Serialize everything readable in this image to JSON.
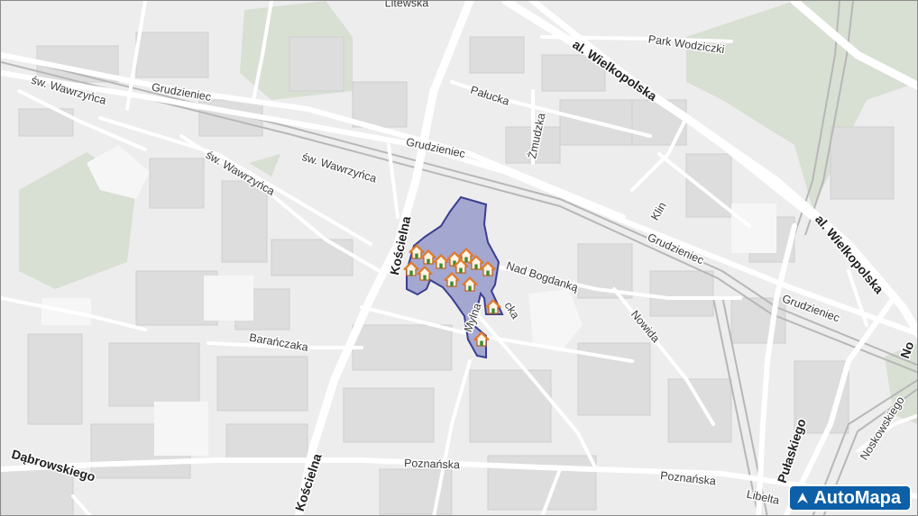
{
  "brand": {
    "name": "AutoMapa"
  },
  "colors": {
    "background": "#ededed",
    "road": "#ffffff",
    "block": "#dcdcdc",
    "green": "#d5ddd1",
    "rail": "#b4b4b4",
    "area_fill": "#8f93c8",
    "area_stroke": "#3a3f8f",
    "marker_house": "#e07b2a"
  },
  "streets": [
    {
      "name": "Litewska"
    },
    {
      "name": "Park Wodziczki"
    },
    {
      "name": "al. Wielkopolska"
    },
    {
      "name": "św. Wawrzyńca"
    },
    {
      "name": "Grudzieniec"
    },
    {
      "name": "Pałucka"
    },
    {
      "name": "Żmudzka"
    },
    {
      "name": "Grudzieniec"
    },
    {
      "name": "św. Wawrzyńca"
    },
    {
      "name": "św. Wawrzyńca"
    },
    {
      "name": "Klin"
    },
    {
      "name": "al. Wielkopolska"
    },
    {
      "name": "Kościelna"
    },
    {
      "name": "Grudzieniec"
    },
    {
      "name": "Nad Bogdanką"
    },
    {
      "name": "Grudzieniec"
    },
    {
      "name": "Nowida"
    },
    {
      "name": "Barańczaka"
    },
    {
      "name": "Noskowskiego"
    },
    {
      "name": "Pułaskiego"
    },
    {
      "name": "Dąbrowskiego"
    },
    {
      "name": "Kościelna"
    },
    {
      "name": "Poznańska"
    },
    {
      "name": "Poznańska"
    },
    {
      "name": "Libelta"
    },
    {
      "name": "Mylna"
    },
    {
      "name": "cka"
    },
    {
      "name": "No"
    }
  ],
  "markers": [
    {
      "icon": "house-marker-icon"
    },
    {
      "icon": "house-marker-icon"
    },
    {
      "icon": "house-marker-icon"
    },
    {
      "icon": "house-marker-icon"
    },
    {
      "icon": "house-marker-icon"
    },
    {
      "icon": "house-marker-icon"
    },
    {
      "icon": "house-marker-icon"
    },
    {
      "icon": "house-marker-icon"
    },
    {
      "icon": "house-marker-icon"
    },
    {
      "icon": "house-marker-icon"
    },
    {
      "icon": "house-marker-icon"
    },
    {
      "icon": "house-marker-icon"
    },
    {
      "icon": "house-marker-icon"
    },
    {
      "icon": "house-marker-icon"
    }
  ]
}
